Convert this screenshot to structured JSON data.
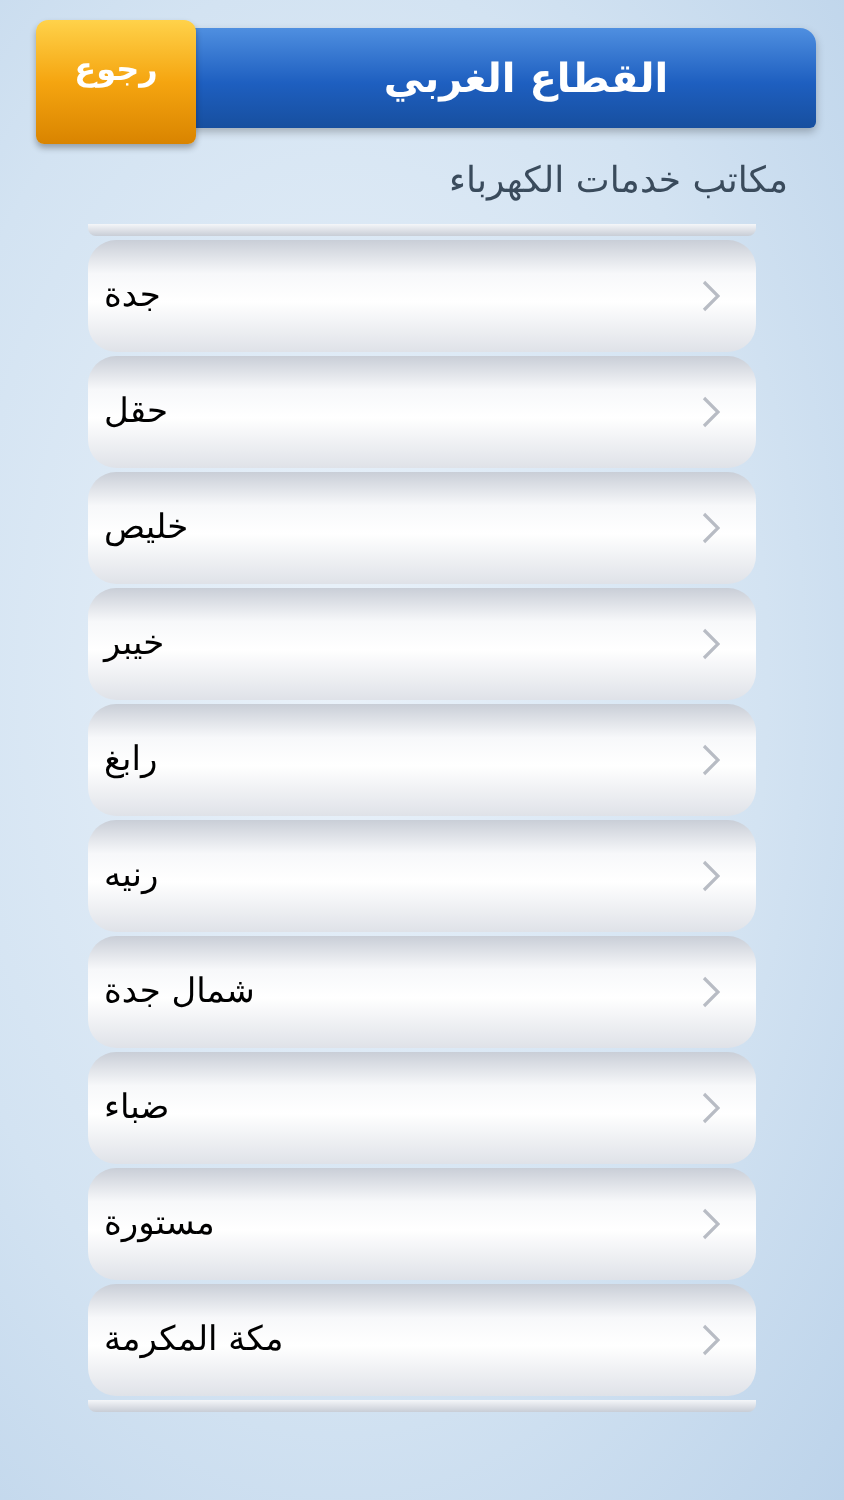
{
  "header": {
    "title": "القطاع الغربي",
    "back_button": "رجوع"
  },
  "subtitle": "مكاتب خدمات الكهرباء",
  "offices": [
    {
      "name": "جدة"
    },
    {
      "name": "حقل"
    },
    {
      "name": "خليص"
    },
    {
      "name": "خيبر"
    },
    {
      "name": "رابغ"
    },
    {
      "name": "رنيه"
    },
    {
      "name": "شمال جدة"
    },
    {
      "name": "ضباء"
    },
    {
      "name": "مستورة"
    },
    {
      "name": "مكة المكرمة"
    }
  ]
}
